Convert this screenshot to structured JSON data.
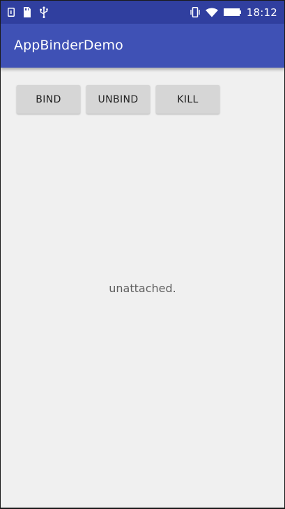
{
  "status_bar": {
    "time": "18:12",
    "left_icons": [
      "sim-icon",
      "sd-card-icon",
      "usb-icon"
    ],
    "right_icons": [
      "vibrate-icon",
      "wifi-icon",
      "battery-icon"
    ]
  },
  "app_bar": {
    "title": "AppBinderDemo",
    "background": "#3f51b5"
  },
  "buttons": [
    {
      "label": "BIND"
    },
    {
      "label": "UNBIND"
    },
    {
      "label": "KILL"
    }
  ],
  "main": {
    "status_text": "unattached."
  },
  "colors": {
    "status_bar": "#303f9f",
    "app_bar": "#3f51b5",
    "background": "#f0f0f0",
    "button": "#d6d6d6"
  }
}
